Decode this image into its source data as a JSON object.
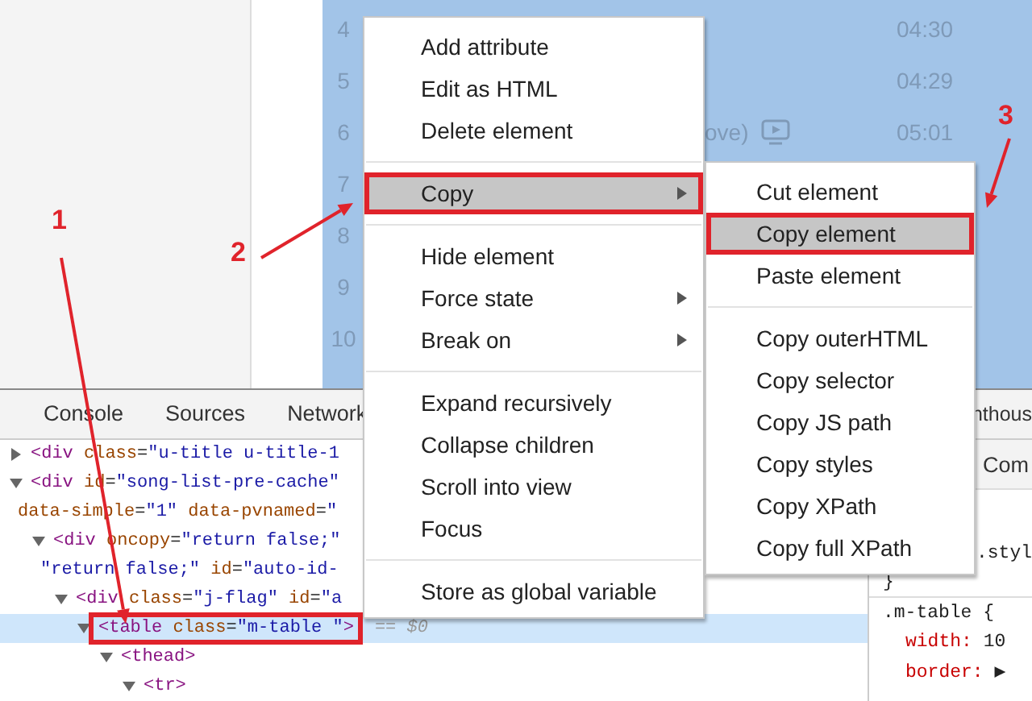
{
  "song_list": {
    "rows": [
      {
        "number": "4",
        "duration": "04:30"
      },
      {
        "number": "5",
        "duration": "04:29"
      },
      {
        "number": "6",
        "title": "ove)",
        "mv": true,
        "duration": "05:01"
      },
      {
        "number": "7"
      },
      {
        "number": "8"
      },
      {
        "number": "9"
      },
      {
        "number": "10"
      }
    ]
  },
  "devtools": {
    "tabs": [
      {
        "label": "Console",
        "selected": false
      },
      {
        "label": "Sources",
        "selected": false
      },
      {
        "label": "Network",
        "selected": false
      }
    ],
    "right_tab": "nthous",
    "tree": [
      {
        "expanded": false,
        "selected": false,
        "lines": [
          [
            {
              "kind": "tag",
              "text": "<div"
            },
            {
              "kind": "attr",
              "text": " class"
            },
            {
              "kind": "plain",
              "text": "="
            },
            {
              "kind": "value",
              "text": "\"u-title u-title-1"
            }
          ]
        ]
      },
      {
        "expanded": true,
        "selected": false,
        "lines": [
          [
            {
              "kind": "tag",
              "text": "<div"
            },
            {
              "kind": "attr",
              "text": " id"
            },
            {
              "kind": "plain",
              "text": "="
            },
            {
              "kind": "value",
              "text": "\"song-list-pre-cache\""
            }
          ],
          [
            {
              "kind": "attr",
              "text": "data-simple"
            },
            {
              "kind": "plain",
              "text": "="
            },
            {
              "kind": "value",
              "text": "\"1\""
            },
            {
              "kind": "attr",
              "text": " data-pvnamed"
            },
            {
              "kind": "plain",
              "text": "="
            },
            {
              "kind": "value",
              "text": "\""
            }
          ]
        ],
        "children": [
          {
            "expanded": true,
            "selected": false,
            "lines": [
              [
                {
                  "kind": "tag",
                  "text": "<div"
                },
                {
                  "kind": "attr",
                  "text": " oncopy"
                },
                {
                  "kind": "plain",
                  "text": "="
                },
                {
                  "kind": "value",
                  "text": "\"return false;\""
                }
              ],
              [
                {
                  "kind": "value",
                  "text": "\"return false;\""
                },
                {
                  "kind": "attr",
                  "text": " id"
                },
                {
                  "kind": "plain",
                  "text": "="
                },
                {
                  "kind": "value",
                  "text": "\"auto-id-"
                }
              ]
            ],
            "children": [
              {
                "expanded": true,
                "selected": false,
                "lines": [
                  [
                    {
                      "kind": "tag",
                      "text": "<div"
                    },
                    {
                      "kind": "attr",
                      "text": " class"
                    },
                    {
                      "kind": "plain",
                      "text": "="
                    },
                    {
                      "kind": "value",
                      "text": "\"j-flag\""
                    },
                    {
                      "kind": "attr",
                      "text": " id"
                    },
                    {
                      "kind": "plain",
                      "text": "="
                    },
                    {
                      "kind": "value",
                      "text": "\"a"
                    }
                  ]
                ],
                "children": [
                  {
                    "expanded": true,
                    "selected": true,
                    "marked": true,
                    "ref": "== $0",
                    "lines": [
                      [
                        {
                          "kind": "tag",
                          "text": "<table"
                        },
                        {
                          "kind": "attr",
                          "text": " class"
                        },
                        {
                          "kind": "plain",
                          "text": "="
                        },
                        {
                          "kind": "value",
                          "text": "\"m-table \""
                        },
                        {
                          "kind": "tag",
                          "text": ">"
                        }
                      ]
                    ],
                    "children": [
                      {
                        "expanded": true,
                        "selected": false,
                        "lines": [
                          [
                            {
                              "kind": "tag",
                              "text": "<thead>"
                            }
                          ]
                        ],
                        "children": [
                          {
                            "expanded": true,
                            "selected": false,
                            "lines": [
                              [
                                {
                                  "kind": "tag",
                                  "text": "<tr>"
                                }
                              ]
                            ]
                          }
                        ]
                      }
                    ]
                  }
                ]
              }
            ]
          }
        ]
      }
    ],
    "styles": {
      "tab": "Com",
      "element_style": ".styl",
      "lines": [
        {
          "kind": "brace",
          "text": "}"
        },
        {
          "kind": "selector",
          "text": ".m-table {"
        },
        {
          "kind": "property",
          "name": "width:",
          "value": "10"
        },
        {
          "kind": "property",
          "name": "border:",
          "value": "▶"
        }
      ]
    }
  },
  "context_menu": {
    "items": [
      {
        "kind": "item",
        "label": "Add attribute",
        "selected": false,
        "marked": false,
        "submenu": false
      },
      {
        "kind": "item",
        "label": "Edit as HTML",
        "selected": false,
        "marked": false,
        "submenu": false
      },
      {
        "kind": "item",
        "label": "Delete element",
        "selected": false,
        "marked": false,
        "submenu": false
      },
      {
        "kind": "separator"
      },
      {
        "kind": "item",
        "label": "Copy",
        "selected": true,
        "marked": true,
        "submenu": true
      },
      {
        "kind": "separator"
      },
      {
        "kind": "item",
        "label": "Hide element",
        "selected": false,
        "marked": false,
        "submenu": false
      },
      {
        "kind": "item",
        "label": "Force state",
        "selected": false,
        "marked": false,
        "submenu": true
      },
      {
        "kind": "item",
        "label": "Break on",
        "selected": false,
        "marked": false,
        "submenu": true
      },
      {
        "kind": "separator"
      },
      {
        "kind": "item",
        "label": "Expand recursively",
        "selected": false,
        "marked": false,
        "submenu": false
      },
      {
        "kind": "item",
        "label": "Collapse children",
        "selected": false,
        "marked": false,
        "submenu": false
      },
      {
        "kind": "item",
        "label": "Scroll into view",
        "selected": false,
        "marked": false,
        "submenu": false
      },
      {
        "kind": "item",
        "label": "Focus",
        "selected": false,
        "marked": false,
        "submenu": false
      },
      {
        "kind": "separator"
      },
      {
        "kind": "item",
        "label": "Store as global variable",
        "selected": false,
        "marked": false,
        "submenu": false
      }
    ]
  },
  "copy_submenu": {
    "items": [
      {
        "kind": "item",
        "label": "Cut element",
        "selected": false,
        "marked": false
      },
      {
        "kind": "item",
        "label": "Copy element",
        "selected": true,
        "marked": true
      },
      {
        "kind": "item",
        "label": "Paste element",
        "selected": false,
        "marked": false
      },
      {
        "kind": "separator"
      },
      {
        "kind": "item",
        "label": "Copy outerHTML",
        "selected": false,
        "marked": false
      },
      {
        "kind": "item",
        "label": "Copy selector",
        "selected": false,
        "marked": false
      },
      {
        "kind": "item",
        "label": "Copy JS path",
        "selected": false,
        "marked": false
      },
      {
        "kind": "item",
        "label": "Copy styles",
        "selected": false,
        "marked": false
      },
      {
        "kind": "item",
        "label": "Copy XPath",
        "selected": false,
        "marked": false
      },
      {
        "kind": "item",
        "label": "Copy full XPath",
        "selected": false,
        "marked": false
      }
    ]
  },
  "annotations": [
    {
      "label": "1"
    },
    {
      "label": "2"
    },
    {
      "label": "3"
    }
  ]
}
